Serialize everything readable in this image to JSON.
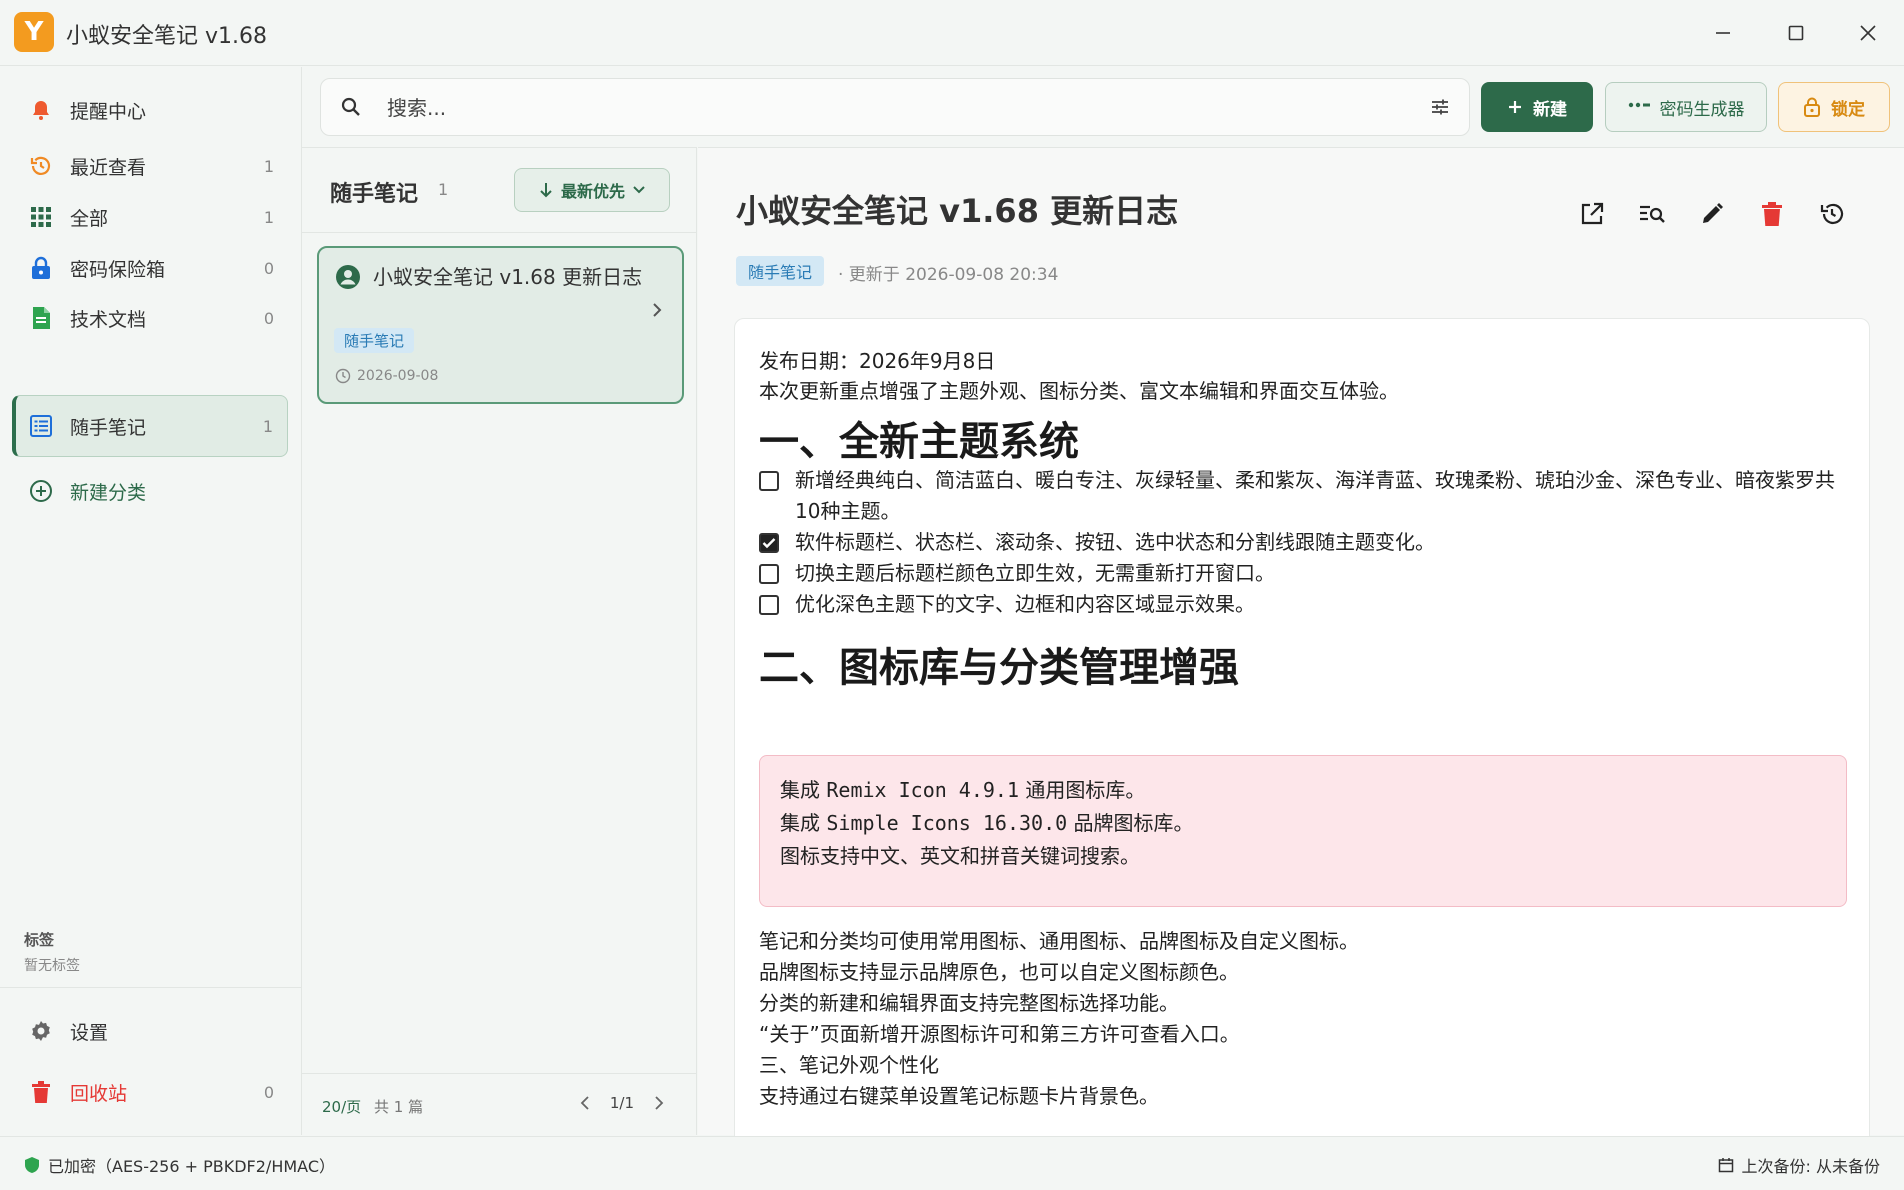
{
  "app": {
    "title": "小蚁安全笔记 v1.68",
    "logo_letter": "Y"
  },
  "sidebar": {
    "items": [
      {
        "label": "提醒中心",
        "count": ""
      },
      {
        "label": "最近查看",
        "count": "1"
      },
      {
        "label": "全部",
        "count": "1"
      },
      {
        "label": "密码保险箱",
        "count": "0"
      },
      {
        "label": "技术文档",
        "count": "0"
      },
      {
        "label": "随手笔记",
        "count": "1"
      },
      {
        "label": "新建分类",
        "count": ""
      }
    ],
    "tags_title": "标签",
    "tags_empty": "暂无标签",
    "settings": "设置",
    "trash": "回收站",
    "trash_count": "0"
  },
  "search": {
    "placeholder": "搜索..."
  },
  "toolbar": {
    "new_label": "新建",
    "pwgen_label": "密码生成器",
    "lock_label": "锁定"
  },
  "list": {
    "title": "随手笔记",
    "count": "1",
    "sort_label": "最新优先",
    "notes": [
      {
        "title": "小蚁安全笔记 v1.68 更新日志",
        "tag": "随手笔记",
        "date": "2026-09-08"
      }
    ],
    "page_size": "20/页",
    "total": "共 1 篇",
    "page": "1/1"
  },
  "detail": {
    "title": "小蚁安全笔记 v1.68 更新日志",
    "tag": "随手笔记",
    "updated": "· 更新于 2026-09-08 20:34",
    "release_date": "发布日期：2026年9月8日",
    "intro": "本次更新重点增强了主题外观、图标分类、富文本编辑和界面交互体验。",
    "h1_a": "一、全新主题系统",
    "todos": [
      {
        "text": "新增经典纯白、简洁蓝白、暖白专注、灰绿轻量、柔和紫灰、海洋青蓝、玫瑰柔粉、琥珀沙金、深色专业、暗夜紫罗共10种主题。",
        "checked": false
      },
      {
        "text": "软件标题栏、状态栏、滚动条、按钮、选中状态和分割线跟随主题变化。",
        "checked": true
      },
      {
        "text": "切换主题后标题栏颜色立即生效，无需重新打开窗口。",
        "checked": false
      },
      {
        "text": "优化深色主题下的文字、边框和内容区域显示效果。",
        "checked": false
      }
    ],
    "h1_b": "二、图标库与分类管理增强",
    "quote": [
      {
        "prefix": "集成 ",
        "code": "Remix Icon 4.9.1",
        "suffix": " 通用图标库。"
      },
      {
        "prefix": "集成 ",
        "code": "Simple Icons 16.30.0",
        "suffix": " 品牌图标库。"
      },
      {
        "prefix": "图标支持中文、英文和拼音关键词搜索。",
        "code": "",
        "suffix": ""
      }
    ],
    "paragraphs": [
      "笔记和分类均可使用常用图标、通用图标、品牌图标及自定义图标。",
      "品牌图标支持显示品牌原色，也可以自定义图标颜色。",
      "分类的新建和编辑界面支持完整图标选择功能。",
      "“关于”页面新增开源图标许可和第三方许可查看入口。",
      "三、笔记外观个性化",
      "支持通过右键菜单设置笔记标题卡片背景色。"
    ]
  },
  "status": {
    "encryption": "已加密（AES-256 + PBKDF2/HMAC）",
    "backup": "上次备份: 从未备份"
  },
  "colors": {
    "accent": "#2d6a4a",
    "lock": "#d88a12",
    "danger": "#e53935",
    "tag_bg": "#d3e8f5",
    "quote_bg": "#fde6ea"
  }
}
